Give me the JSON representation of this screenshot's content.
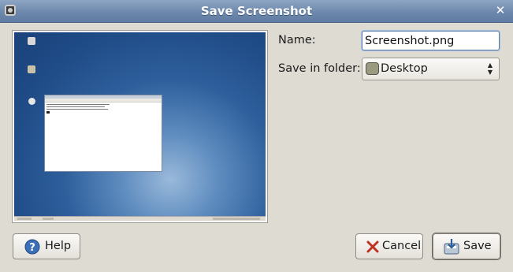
{
  "window": {
    "title": "Save Screenshot"
  },
  "form": {
    "name_label": "Name:",
    "name_value": "Screenshot.png",
    "folder_label": "Save in folder:",
    "folder_value": "Desktop"
  },
  "buttons": {
    "help": "Help",
    "cancel": "Cancel",
    "save": "Save"
  },
  "icons": {
    "window_menu": "window-menu-icon",
    "close": "close-icon",
    "folder": "folder-icon",
    "combo_arrows": "combo-arrows-icon",
    "help": "help-icon",
    "cancel": "cancel-icon",
    "save": "save-icon"
  },
  "colors": {
    "titlebar": "#6d88ac",
    "dialog_bg": "#dedbd3",
    "preview_desktop": "#2e5f9c"
  }
}
